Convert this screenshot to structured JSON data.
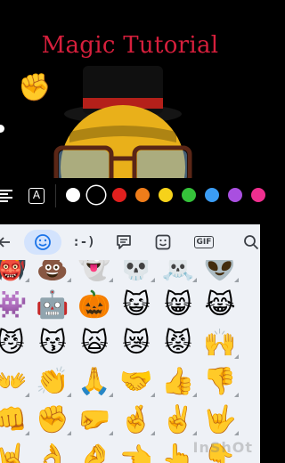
{
  "canvas": {
    "title_text": "Magic Tutorial",
    "title_color": "#d61f3c"
  },
  "toolbar": {
    "align_icon": "text-align-icon",
    "font_icon_glyph": "A",
    "colors": [
      {
        "name": "white",
        "hex": "#ffffff",
        "selected": false
      },
      {
        "name": "black",
        "hex": "#000000",
        "selected": true
      },
      {
        "name": "red",
        "hex": "#e0201e",
        "selected": false
      },
      {
        "name": "orange",
        "hex": "#ef7d1a",
        "selected": false
      },
      {
        "name": "yellow",
        "hex": "#f6d21a",
        "selected": false
      },
      {
        "name": "green",
        "hex": "#35c23a",
        "selected": false
      },
      {
        "name": "blue",
        "hex": "#3b9df5",
        "selected": false
      },
      {
        "name": "purple",
        "hex": "#a94fe0",
        "selected": false
      },
      {
        "name": "pink",
        "hex": "#ef2f8f",
        "selected": false
      }
    ]
  },
  "keyboard": {
    "tabs": [
      {
        "name": "back-arrow-icon",
        "active": false
      },
      {
        "name": "emoji-tab",
        "active": true
      },
      {
        "name": "emoticon-tab",
        "glyph": ":-)",
        "active": false
      },
      {
        "name": "sticker-tab",
        "active": false
      },
      {
        "name": "bitmoji-tab",
        "active": false
      },
      {
        "name": "gif-tab",
        "glyph": "GIF",
        "active": false
      },
      {
        "name": "search-icon",
        "active": false
      }
    ],
    "emoji_rows": [
      [
        "👹",
        "💩",
        "👻",
        "💀",
        "☠️",
        "👽"
      ],
      [
        "👾",
        "🤖",
        "🎃",
        "😺",
        "😸",
        "😹"
      ],
      [
        "😼",
        "😽",
        "🙀",
        "😿",
        "😾",
        "🙌"
      ],
      [
        "👐",
        "👏",
        "🙏",
        "🤝",
        "👍",
        "👎"
      ],
      [
        "👊",
        "✊",
        "🤛",
        "🤞",
        "✌️",
        "🤟"
      ],
      [
        "🤘",
        "👌",
        "🤌",
        "👈",
        "👆",
        "👇"
      ]
    ],
    "variant_cells": [
      [
        0,
        0
      ],
      [
        0,
        1
      ],
      [
        0,
        2
      ],
      [
        0,
        3
      ],
      [
        0,
        4
      ],
      [
        0,
        5
      ],
      [
        2,
        5
      ],
      [
        3,
        0
      ],
      [
        3,
        1
      ],
      [
        3,
        2
      ],
      [
        3,
        3
      ],
      [
        3,
        4
      ],
      [
        3,
        5
      ],
      [
        4,
        0
      ],
      [
        4,
        1
      ],
      [
        4,
        2
      ],
      [
        4,
        3
      ],
      [
        4,
        4
      ],
      [
        4,
        5
      ],
      [
        5,
        0
      ],
      [
        5,
        1
      ],
      [
        5,
        2
      ],
      [
        5,
        3
      ],
      [
        5,
        4
      ],
      [
        5,
        5
      ]
    ]
  },
  "watermark": "InShOt"
}
